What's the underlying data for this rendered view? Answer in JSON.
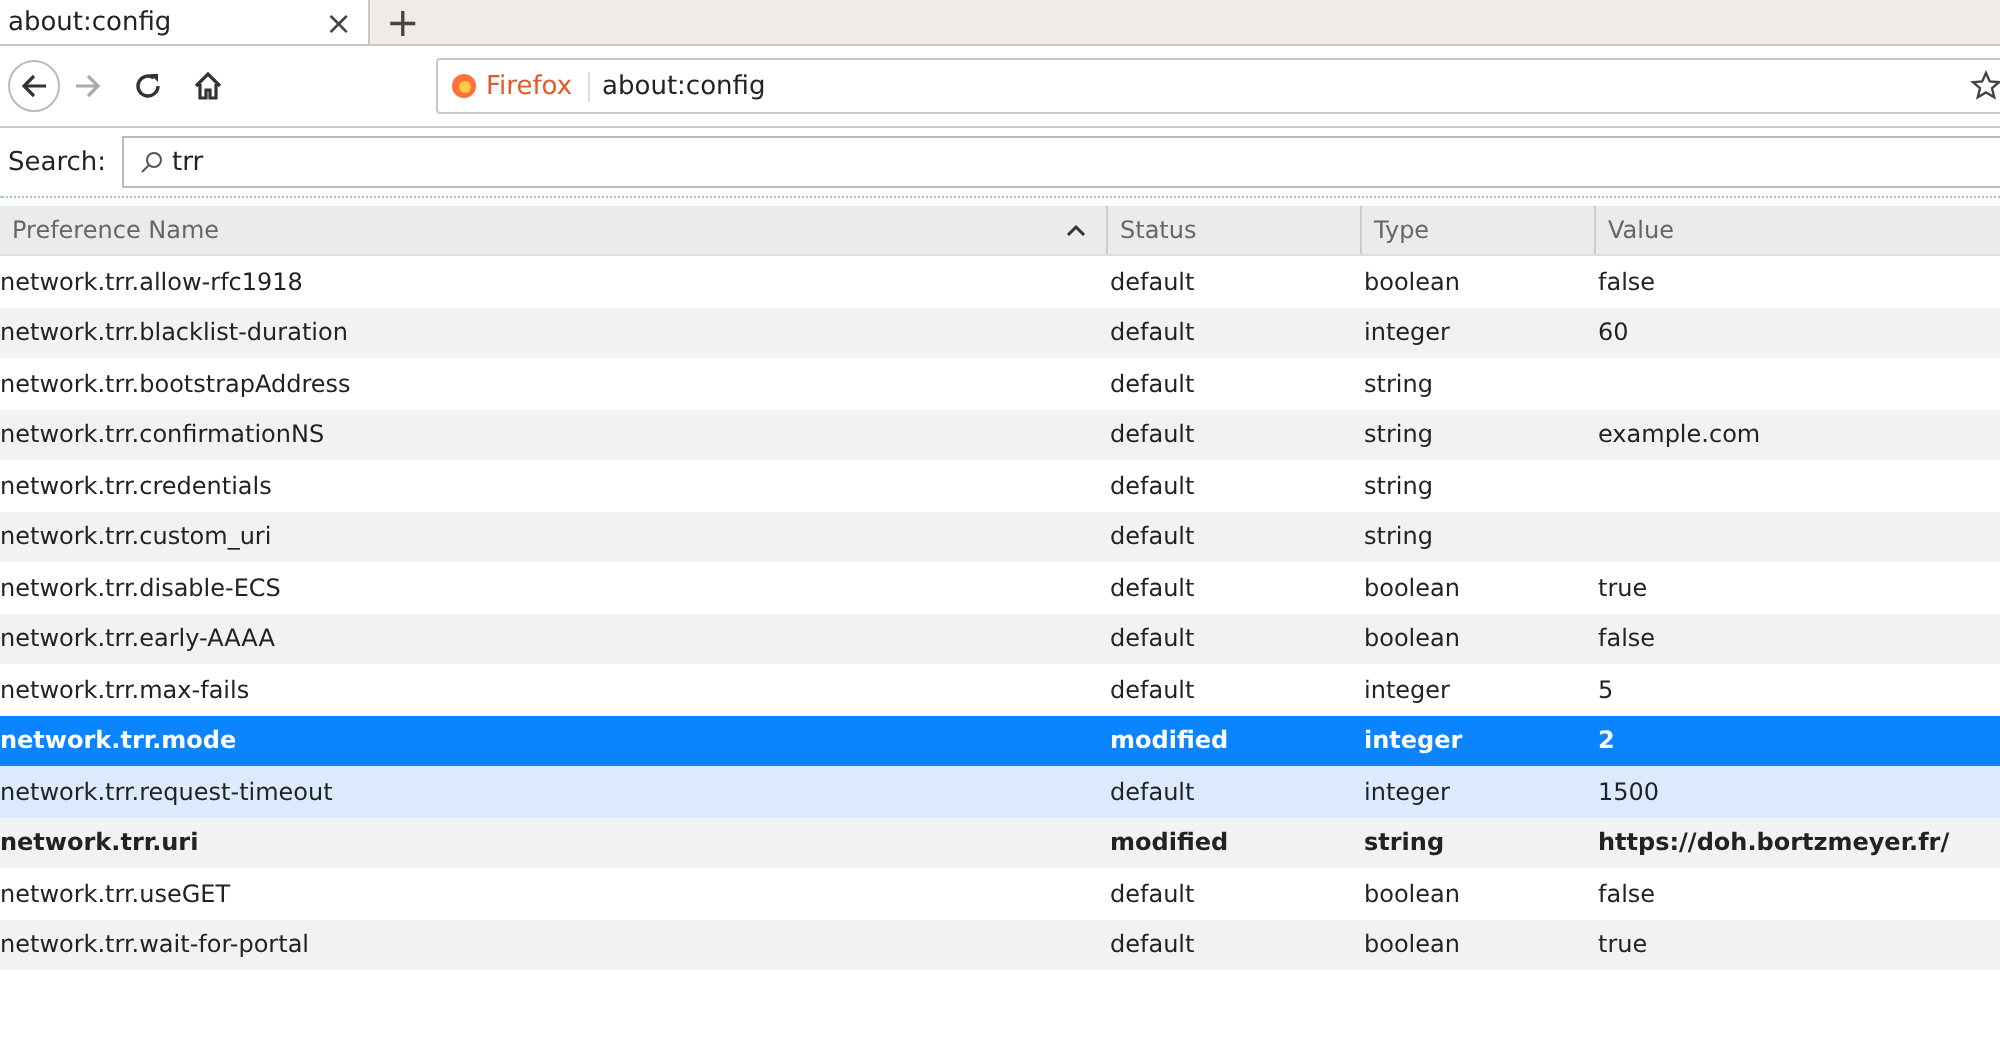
{
  "tab": {
    "title": "about:config",
    "close": "×",
    "new_tab": "+",
    "selected": true
  },
  "address_bar": {
    "identity": "Firefox",
    "url": "about:config"
  },
  "search": {
    "label": "Search:",
    "value": "trr"
  },
  "columns": [
    {
      "label": "Preference Name",
      "sorted": true
    },
    {
      "label": "Status",
      "sorted": false
    },
    {
      "label": "Type",
      "sorted": false
    },
    {
      "label": "Value",
      "sorted": false
    }
  ],
  "rows": [
    {
      "name": "network.trr.allow-rfc1918",
      "status": "default",
      "type": "boolean",
      "value": "false",
      "modified": false,
      "selected": false,
      "hovered": false
    },
    {
      "name": "network.trr.blacklist-duration",
      "status": "default",
      "type": "integer",
      "value": "60",
      "modified": false,
      "selected": false,
      "hovered": false
    },
    {
      "name": "network.trr.bootstrapAddress",
      "status": "default",
      "type": "string",
      "value": "",
      "modified": false,
      "selected": false,
      "hovered": false
    },
    {
      "name": "network.trr.confirmationNS",
      "status": "default",
      "type": "string",
      "value": "example.com",
      "modified": false,
      "selected": false,
      "hovered": false
    },
    {
      "name": "network.trr.credentials",
      "status": "default",
      "type": "string",
      "value": "",
      "modified": false,
      "selected": false,
      "hovered": false
    },
    {
      "name": "network.trr.custom_uri",
      "status": "default",
      "type": "string",
      "value": "",
      "modified": false,
      "selected": false,
      "hovered": false
    },
    {
      "name": "network.trr.disable-ECS",
      "status": "default",
      "type": "boolean",
      "value": "true",
      "modified": false,
      "selected": false,
      "hovered": false
    },
    {
      "name": "network.trr.early-AAAA",
      "status": "default",
      "type": "boolean",
      "value": "false",
      "modified": false,
      "selected": false,
      "hovered": false
    },
    {
      "name": "network.trr.max-fails",
      "status": "default",
      "type": "integer",
      "value": "5",
      "modified": false,
      "selected": false,
      "hovered": false
    },
    {
      "name": "network.trr.mode",
      "status": "modified",
      "type": "integer",
      "value": "2",
      "modified": true,
      "selected": true,
      "hovered": false
    },
    {
      "name": "network.trr.request-timeout",
      "status": "default",
      "type": "integer",
      "value": "1500",
      "modified": false,
      "selected": false,
      "hovered": true
    },
    {
      "name": "network.trr.uri",
      "status": "modified",
      "type": "string",
      "value": "https://doh.bortzmeyer.fr/",
      "modified": true,
      "selected": false,
      "hovered": false
    },
    {
      "name": "network.trr.useGET",
      "status": "default",
      "type": "boolean",
      "value": "false",
      "modified": false,
      "selected": false,
      "hovered": false
    },
    {
      "name": "network.trr.wait-for-portal",
      "status": "default",
      "type": "boolean",
      "value": "true",
      "modified": false,
      "selected": false,
      "hovered": false
    }
  ]
}
